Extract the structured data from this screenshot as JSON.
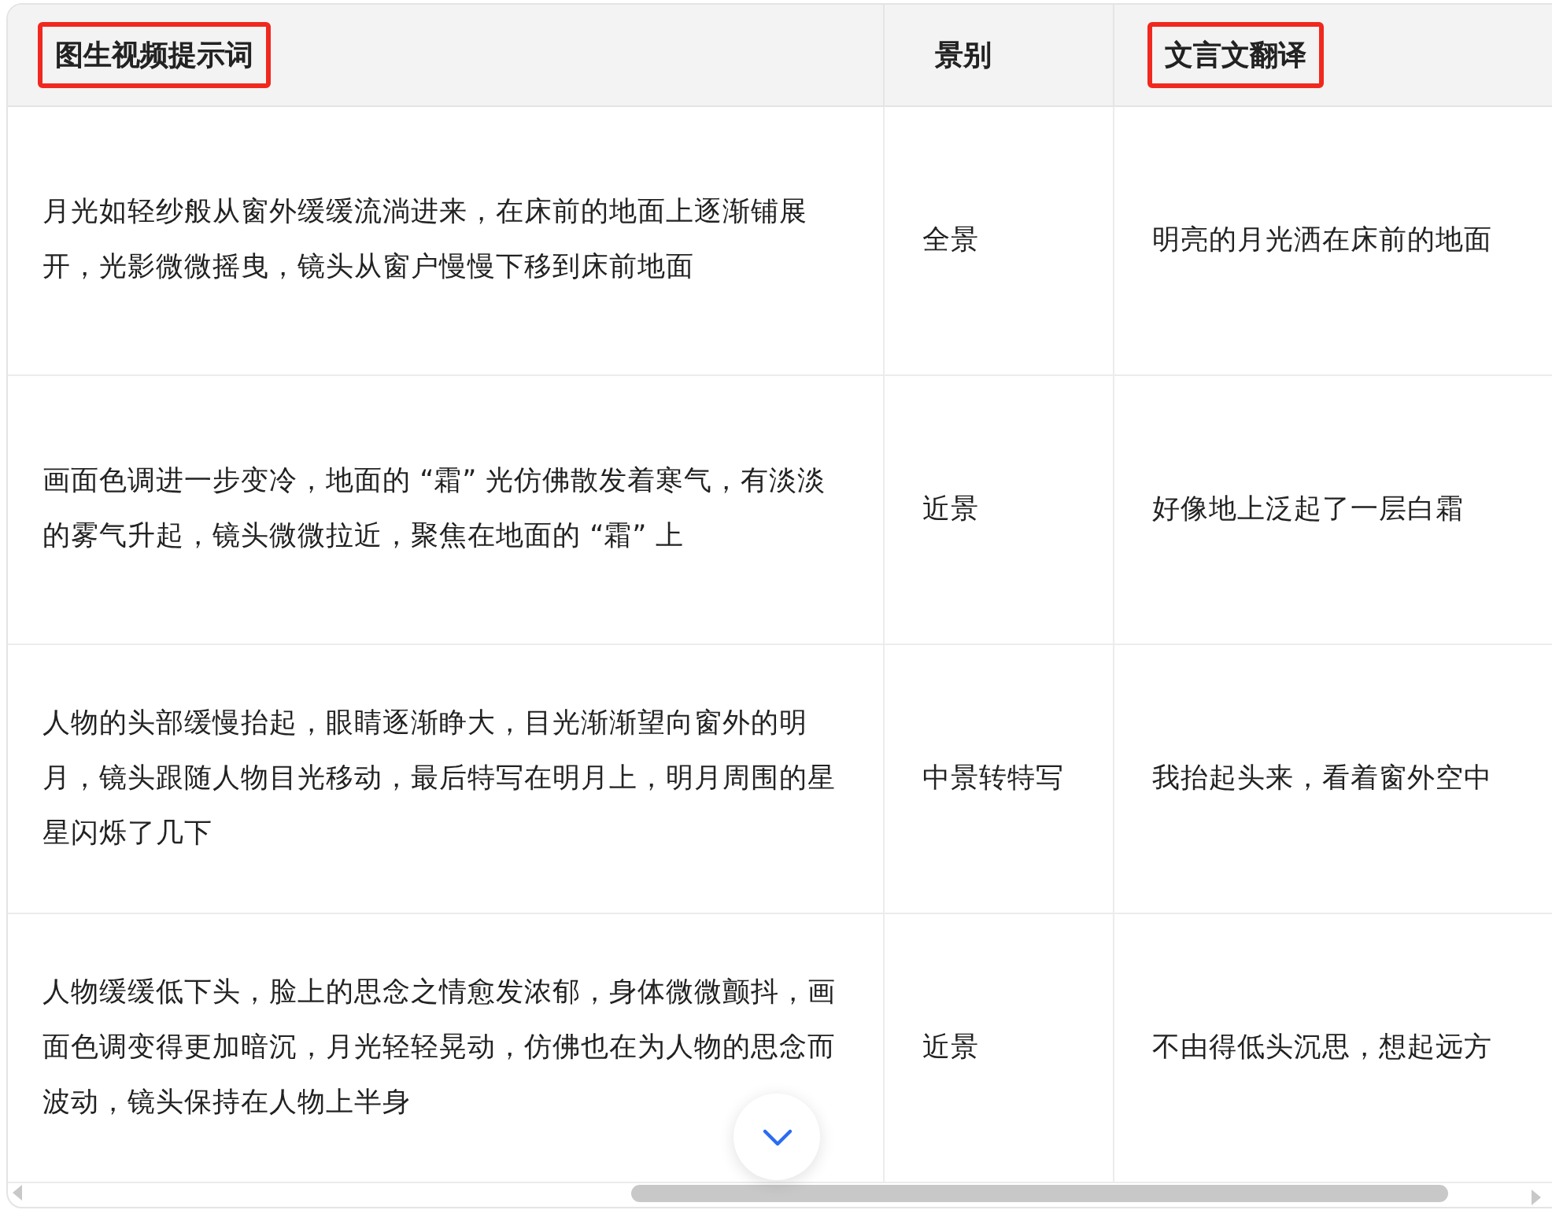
{
  "table": {
    "columns": [
      {
        "label": "图生视频提示词",
        "highlighted": true
      },
      {
        "label": "景别",
        "highlighted": false
      },
      {
        "label": "文言文翻译",
        "highlighted": true
      }
    ],
    "rows": [
      {
        "cells": [
          "月光如轻纱般从窗外缓缓流淌进来，在床前的地面上逐渐铺展开，光影微微摇曳，镜头从窗户慢慢下移到床前地面",
          "全景",
          "明亮的月光洒在床前的地面"
        ]
      },
      {
        "cells": [
          "画面色调进一步变冷，地面的 “霜” 光仿佛散发着寒气，有淡淡的雾气升起，镜头微微拉近，聚焦在地面的 “霜” 上",
          "近景",
          "好像地上泛起了一层白霜"
        ]
      },
      {
        "cells": [
          "人物的头部缓慢抬起，眼睛逐渐睁大，目光渐渐望向窗外的明月，镜头跟随人物目光移动，最后特写在明月上，明月周围的星星闪烁了几下",
          "中景转特写",
          "我抬起头来，看着窗外空中"
        ]
      },
      {
        "cells": [
          "人物缓缓低下头，脸上的思念之情愈发浓郁，身体微微颤抖，画面色调变得更加暗沉，月光轻轻晃动，仿佛也在为人物的思念而波动，镜头保持在人物上半身",
          "近景",
          "不由得低头沉思，想起远方"
        ]
      }
    ]
  }
}
